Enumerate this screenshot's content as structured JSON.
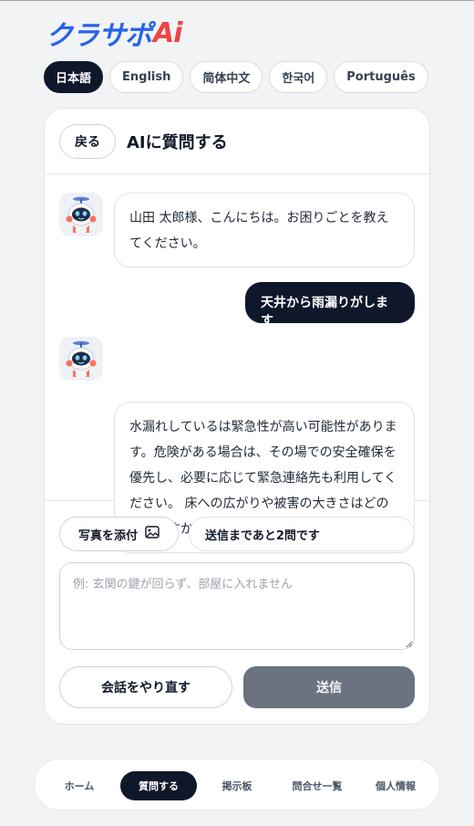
{
  "logo": {
    "jp": "クラサポ",
    "ai": "Ai"
  },
  "languages": [
    {
      "label": "日本語",
      "active": true
    },
    {
      "label": "English",
      "active": false
    },
    {
      "label": "简体中文",
      "active": false
    },
    {
      "label": "한국어",
      "active": false
    },
    {
      "label": "Português",
      "active": false
    }
  ],
  "header": {
    "back_label": "戻る",
    "title": "AIに質問する"
  },
  "chat": {
    "messages": [
      {
        "role": "bot",
        "text": "山田 太郎様、こんにちは。お困りごとを教えてください。"
      },
      {
        "role": "user",
        "text": "天井から雨漏りがします"
      },
      {
        "role": "bot",
        "text": "水漏れしているは緊急性が高い可能性があります。危険がある場合は、その場での安全確保を優先し、必要に応じて緊急連絡先も利用してください。 床への広がりや被害の大きさはどの程度ですか？"
      }
    ]
  },
  "tools": {
    "attach_photo_label": "写真を添付",
    "remaining_text": "送信まであと2問です",
    "input_placeholder": "例: 玄関の鍵が回らず、部屋に入れません",
    "input_value": "",
    "restart_label": "会話をやり直す",
    "send_label": "送信"
  },
  "bottom_nav": [
    {
      "label": "ホーム",
      "active": false
    },
    {
      "label": "質問する",
      "active": true
    },
    {
      "label": "掲示板",
      "active": false
    },
    {
      "label": "問合せ一覧",
      "active": false
    },
    {
      "label": "個人情報",
      "active": false
    }
  ],
  "colors": {
    "brand_blue": "#2563eb",
    "brand_red": "#ef4444",
    "dark": "#0f172a",
    "send_disabled": "#6b7280"
  },
  "icons": {
    "bot_avatar": "robot-mascot-icon",
    "photo": "image-icon"
  }
}
